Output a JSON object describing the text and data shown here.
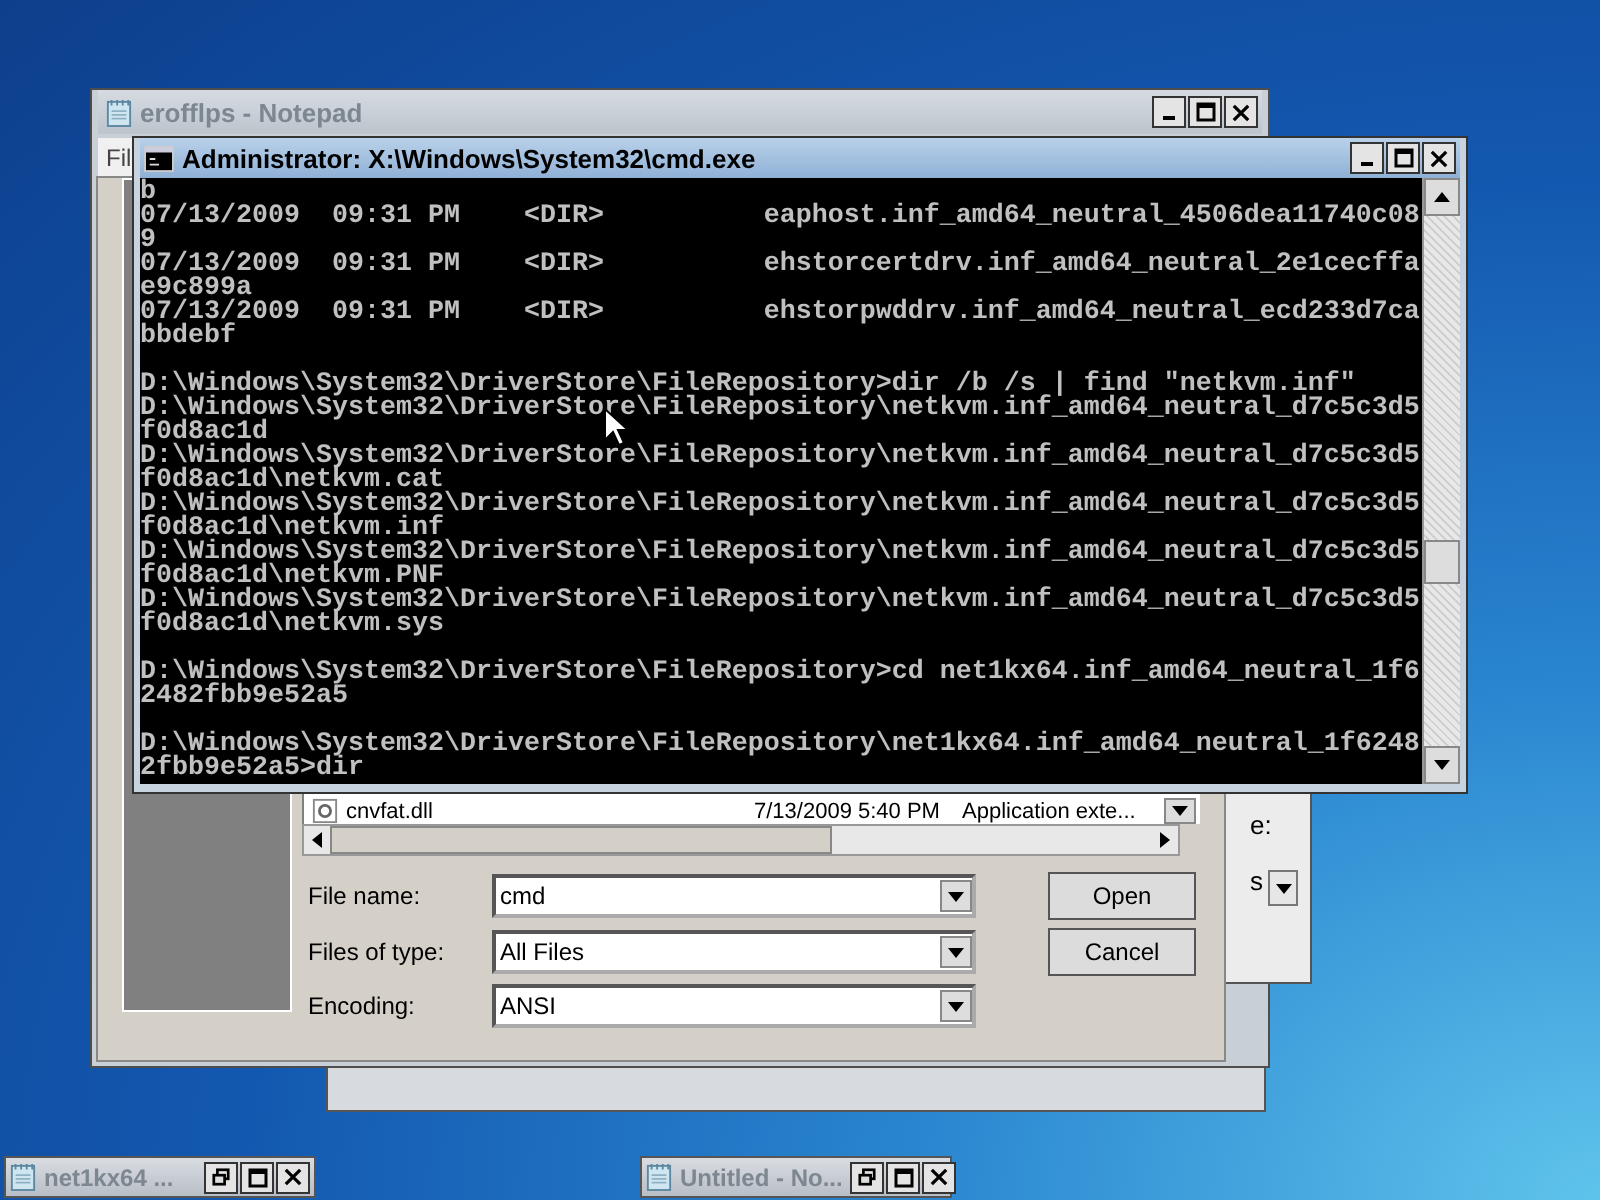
{
  "notepad": {
    "title": "erofflps - Notepad",
    "menu": [
      "Fil"
    ]
  },
  "side_window": {
    "texts": [
      "e:",
      "s"
    ]
  },
  "open_dialog": {
    "file_list": {
      "rows": [
        {
          "name": "cnvfat.dll",
          "date": "7/13/2009 5:40 PM",
          "type": "Application exte..."
        }
      ]
    },
    "fields": [
      {
        "label": "File name:",
        "value": "cmd"
      },
      {
        "label": "Files of type:",
        "value": "All Files"
      },
      {
        "label": "Encoding:",
        "value": "ANSI"
      }
    ],
    "buttons": [
      "Open",
      "Cancel"
    ]
  },
  "console": {
    "title": "Administrator: X:\\Windows\\System32\\cmd.exe",
    "blocks": [
      [
        "b",
        "07/13/2009  09:31 PM    <DIR>          eaphost.inf_amd64_neutral_4506dea11740c08",
        "9",
        "07/13/2009  09:31 PM    <DIR>          ehstorcertdrv.inf_amd64_neutral_2e1cecffa",
        "e9c899a",
        "07/13/2009  09:31 PM    <DIR>          ehstorpwddrv.inf_amd64_neutral_ecd233d7ca",
        "bbdebf"
      ],
      [
        "D:\\Windows\\System32\\DriverStore\\FileRepository>dir /b /s | find \"netkvm.inf\"",
        "D:\\Windows\\System32\\DriverStore\\FileRepository\\netkvm.inf_amd64_neutral_d7c5c3d5",
        "f0d8ac1d",
        "D:\\Windows\\System32\\DriverStore\\FileRepository\\netkvm.inf_amd64_neutral_d7c5c3d5",
        "f0d8ac1d\\netkvm.cat",
        "D:\\Windows\\System32\\DriverStore\\FileRepository\\netkvm.inf_amd64_neutral_d7c5c3d5",
        "f0d8ac1d\\netkvm.inf",
        "D:\\Windows\\System32\\DriverStore\\FileRepository\\netkvm.inf_amd64_neutral_d7c5c3d5",
        "f0d8ac1d\\netkvm.PNF",
        "D:\\Windows\\System32\\DriverStore\\FileRepository\\netkvm.inf_amd64_neutral_d7c5c3d5",
        "f0d8ac1d\\netkvm.sys"
      ],
      [
        "D:\\Windows\\System32\\DriverStore\\FileRepository>cd net1kx64.inf_amd64_neutral_1f6",
        "2482fbb9e52a5"
      ],
      [
        "D:\\Windows\\System32\\DriverStore\\FileRepository\\net1kx64.inf_amd64_neutral_1f6248",
        "2fbb9e52a5>dir"
      ]
    ]
  },
  "minimized_windows": [
    {
      "title": "net1kx64 ..."
    },
    {
      "title": "Untitled - No..."
    }
  ]
}
